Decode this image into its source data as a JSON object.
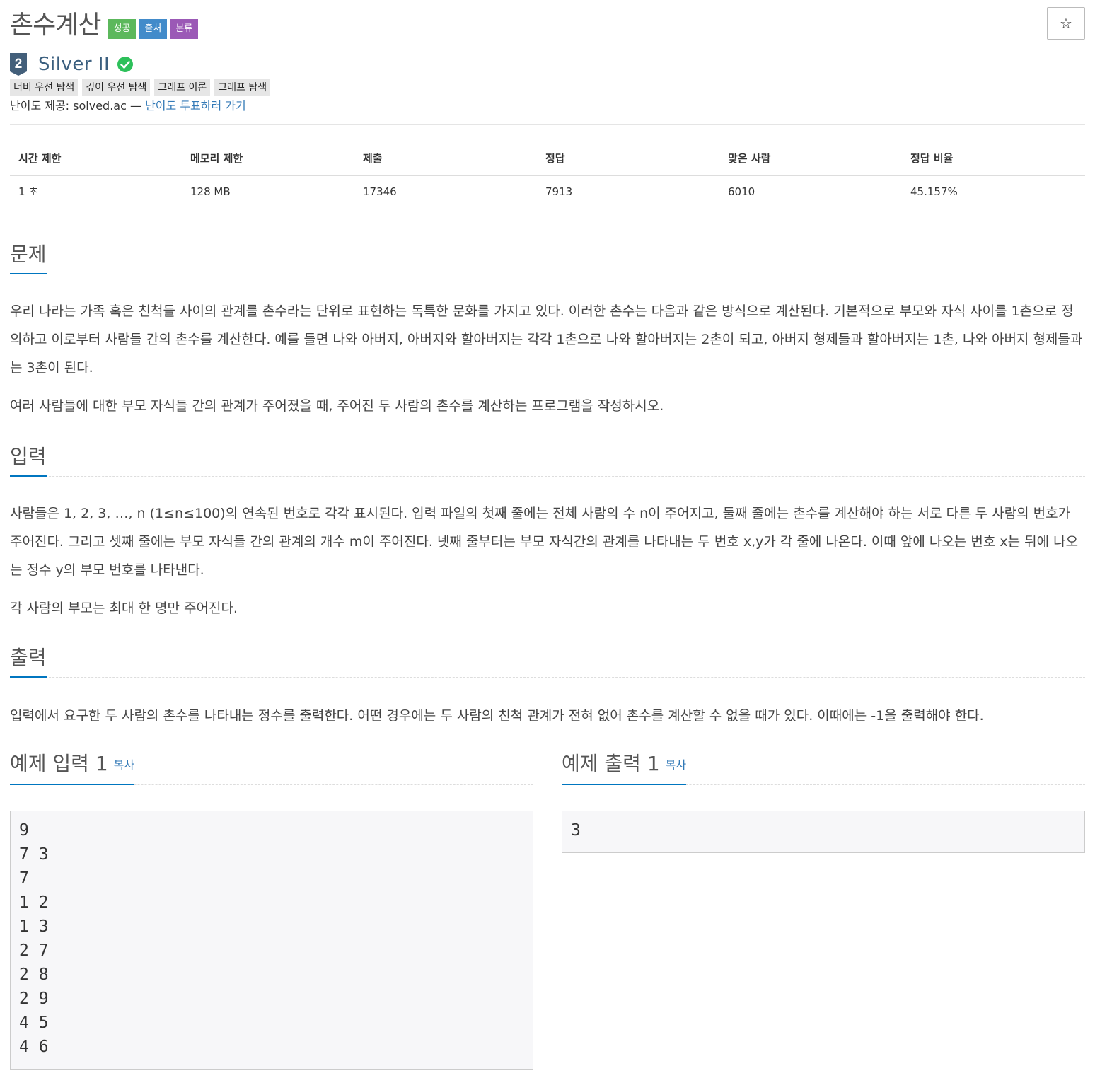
{
  "header": {
    "title": "촌수계산",
    "badges": {
      "success": "성공",
      "source": "출처",
      "category": "분류"
    },
    "star": "☆"
  },
  "tier": {
    "level": "2",
    "name": "Silver II",
    "icon": "silver-tier-icon",
    "solved_icon": "check-circle-icon"
  },
  "tags": [
    "너비 우선 탐색",
    "깊이 우선 탐색",
    "그래프 이론",
    "그래프 탐색"
  ],
  "difficulty": {
    "prefix": "난이도 제공: solved.ac —",
    "link": "난이도 투표하러 가기"
  },
  "info_table": {
    "headers": [
      "시간 제한",
      "메모리 제한",
      "제출",
      "정답",
      "맞은 사람",
      "정답 비율"
    ],
    "values": [
      "1 초",
      "128 MB",
      "17346",
      "7913",
      "6010",
      "45.157%"
    ]
  },
  "sections": {
    "problem": {
      "title": "문제",
      "paragraphs": [
        "우리 나라는 가족 혹은 친척들 사이의 관계를 촌수라는 단위로 표현하는 독특한 문화를 가지고 있다. 이러한 촌수는 다음과 같은 방식으로 계산된다. 기본적으로 부모와 자식 사이를 1촌으로 정의하고 이로부터 사람들 간의 촌수를 계산한다. 예를 들면 나와 아버지, 아버지와 할아버지는 각각 1촌으로 나와 할아버지는 2촌이 되고, 아버지 형제들과 할아버지는 1촌, 나와 아버지 형제들과는 3촌이 된다.",
        "여러 사람들에 대한 부모 자식들 간의 관계가 주어졌을 때, 주어진 두 사람의 촌수를 계산하는 프로그램을 작성하시오."
      ]
    },
    "input": {
      "title": "입력",
      "paragraphs": [
        "사람들은 1, 2, 3, …, n (1≤n≤100)의 연속된 번호로 각각 표시된다. 입력 파일의 첫째 줄에는 전체 사람의 수 n이 주어지고, 둘째 줄에는 촌수를 계산해야 하는 서로 다른 두 사람의 번호가 주어진다. 그리고 셋째 줄에는 부모 자식들 간의 관계의 개수 m이 주어진다. 넷째 줄부터는 부모 자식간의 관계를 나타내는 두 번호 x,y가 각 줄에 나온다. 이때 앞에 나오는 번호 x는 뒤에 나오는 정수 y의 부모 번호를 나타낸다.",
        "각 사람의 부모는 최대 한 명만 주어진다."
      ]
    },
    "output": {
      "title": "출력",
      "paragraphs": [
        "입력에서 요구한 두 사람의 촌수를 나타내는 정수를 출력한다. 어떤 경우에는 두 사람의 친척 관계가 전혀 없어 촌수를 계산할 수 없을 때가 있다. 이때에는 -1을 출력해야 한다."
      ]
    }
  },
  "samples": {
    "input": {
      "title": "예제 입력 1",
      "copy": "복사",
      "content": "9\n7 3\n7\n1 2\n1 3\n2 7\n2 8\n2 9\n4 5\n4 6"
    },
    "output": {
      "title": "예제 출력 1",
      "copy": "복사",
      "content": "3"
    }
  }
}
